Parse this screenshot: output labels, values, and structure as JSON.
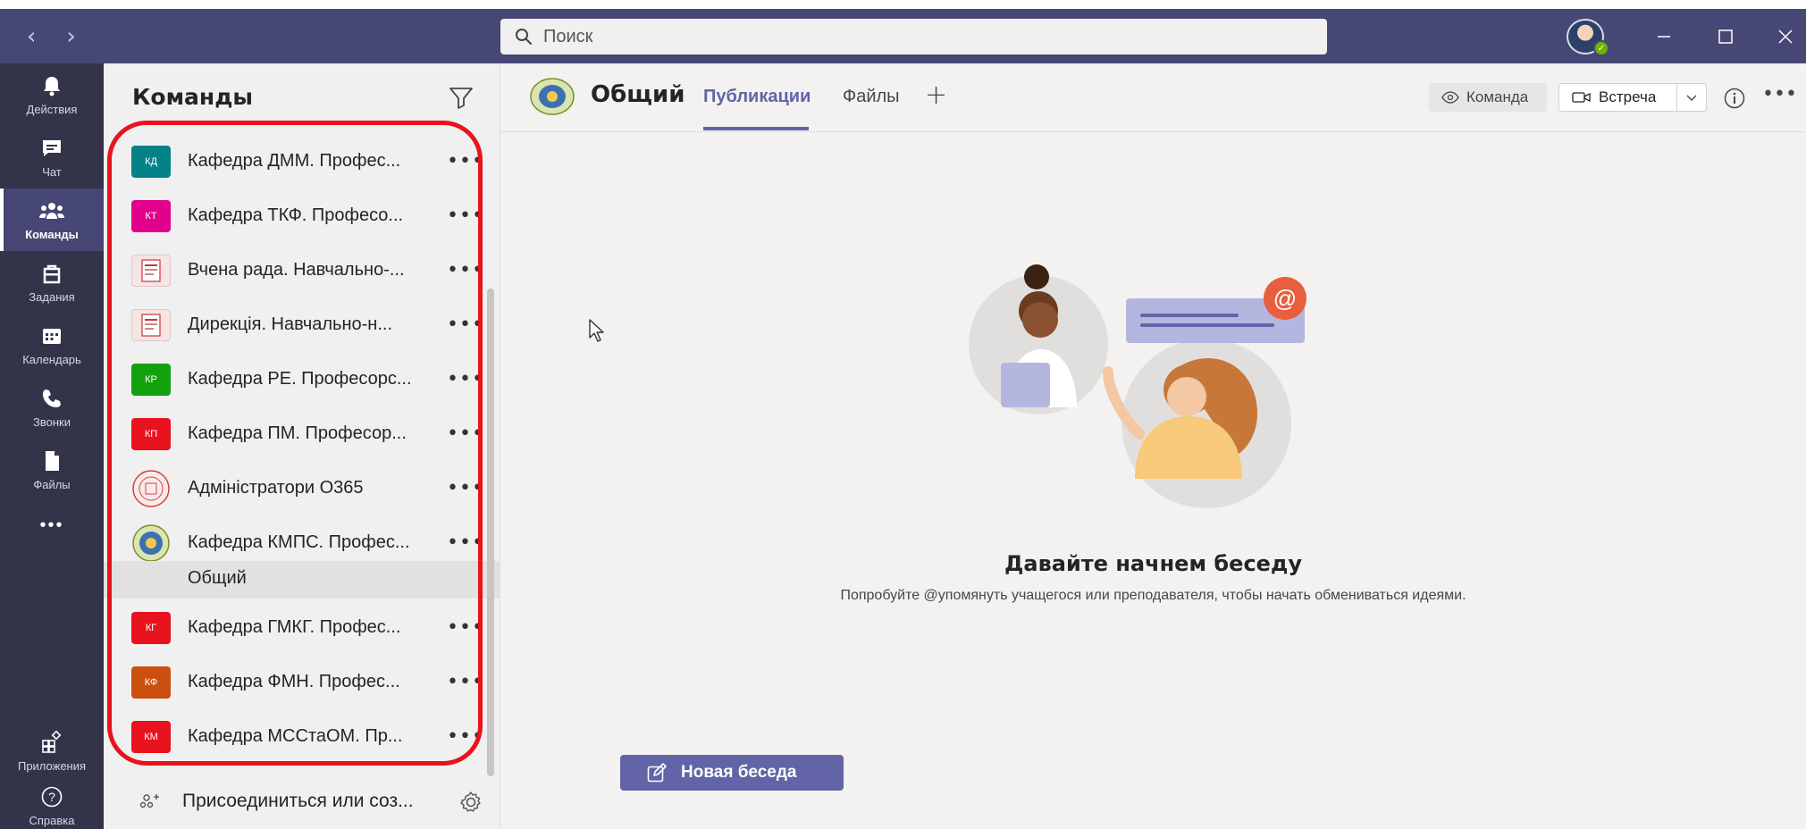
{
  "titlebar": {
    "search_placeholder": "Поиск"
  },
  "rail": {
    "items": [
      {
        "label": "Действия",
        "icon": "bell-icon"
      },
      {
        "label": "Чат",
        "icon": "chat-icon"
      },
      {
        "label": "Команды",
        "icon": "teams-icon"
      },
      {
        "label": "Задания",
        "icon": "assignments-icon"
      },
      {
        "label": "Календарь",
        "icon": "calendar-icon"
      },
      {
        "label": "Звонки",
        "icon": "phone-icon"
      },
      {
        "label": "Файлы",
        "icon": "files-icon"
      }
    ],
    "more": "•••",
    "bottom": [
      {
        "label": "Приложения",
        "icon": "apps-icon"
      },
      {
        "label": "Справка",
        "icon": "help-icon"
      }
    ]
  },
  "panel": {
    "title": "Команды",
    "teams": [
      {
        "initials": "КД",
        "name": "Кафедра ДММ. Профес...",
        "color": "#038387"
      },
      {
        "initials": "КТ",
        "name": "Кафедра ТКФ. Професо...",
        "color": "#e3008c"
      },
      {
        "initials": "",
        "name": "Вчена рада. Навчально-...",
        "color": "doc"
      },
      {
        "initials": "",
        "name": "Дирекція. Навчально-н...",
        "color": "doc"
      },
      {
        "initials": "КР",
        "name": "Кафедра РЕ. Професорс...",
        "color": "#13a10e"
      },
      {
        "initials": "КП",
        "name": "Кафедра ПМ. Професор...",
        "color": "#e8131e"
      },
      {
        "initials": "",
        "name": "Адміністратори О365",
        "color": "seal-red"
      },
      {
        "initials": "",
        "name": "Кафедра КМПС. Профес...",
        "color": "seal-green"
      },
      {
        "initials": "КГ",
        "name": "Кафедра ГМКГ. Профес...",
        "color": "#e8131e"
      },
      {
        "initials": "КФ",
        "name": "Кафедра ФМН. Профес...",
        "color": "#ca5010"
      },
      {
        "initials": "КМ",
        "name": "Кафедра МССтаОМ. Пр...",
        "color": "#e8131e"
      }
    ],
    "channel": "Общий",
    "join_label": "Присоединиться или соз...",
    "more": "•••"
  },
  "main": {
    "channel_title": "Общий",
    "tabs": [
      "Публикации",
      "Файлы"
    ],
    "btn_team": "Команда",
    "btn_meet": "Встреча",
    "empty_title": "Давайте начнем беседу",
    "empty_sub": "Попробуйте @упомянуть учащегося или преподавателя, чтобы начать обмениваться идеями.",
    "new_conv": "Новая беседа",
    "more": "•••"
  },
  "colors": {
    "brand": "#6264a7",
    "titlebar": "#464775",
    "rail": "#33344a",
    "highlight": "#e8131e"
  }
}
